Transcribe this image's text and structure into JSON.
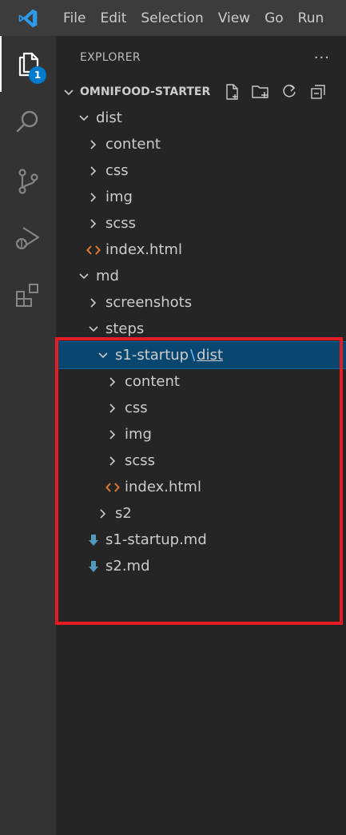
{
  "menu": [
    "File",
    "Edit",
    "Selection",
    "View",
    "Go",
    "Run"
  ],
  "activity": {
    "explorer_badge": "1"
  },
  "sidebar": {
    "title": "EXPLORER",
    "more": "···",
    "section_title": "OMNIFOOD-STARTER",
    "tree": [
      {
        "label": "dist",
        "depth": 0,
        "type": "folder-open"
      },
      {
        "label": "content",
        "depth": 1,
        "type": "folder"
      },
      {
        "label": "css",
        "depth": 1,
        "type": "folder"
      },
      {
        "label": "img",
        "depth": 1,
        "type": "folder"
      },
      {
        "label": "scss",
        "depth": 1,
        "type": "folder"
      },
      {
        "label": "index.html",
        "depth": 1,
        "type": "html"
      },
      {
        "label": "md",
        "depth": 0,
        "type": "folder-open"
      },
      {
        "label": "screenshots",
        "depth": 1,
        "type": "folder"
      },
      {
        "label": "steps",
        "depth": 1,
        "type": "folder-open"
      },
      {
        "label": "s1-startup",
        "sep": "\\",
        "link": "dist",
        "depth": 2,
        "type": "folder-open",
        "selected": true
      },
      {
        "label": "content",
        "depth": 3,
        "type": "folder"
      },
      {
        "label": "css",
        "depth": 3,
        "type": "folder"
      },
      {
        "label": "img",
        "depth": 3,
        "type": "folder"
      },
      {
        "label": "scss",
        "depth": 3,
        "type": "folder"
      },
      {
        "label": "index.html",
        "depth": 3,
        "type": "html"
      },
      {
        "label": "s2",
        "depth": 2,
        "type": "folder"
      },
      {
        "label": "s1-startup.md",
        "depth": 1,
        "type": "md"
      },
      {
        "label": "s2.md",
        "depth": 1,
        "type": "md"
      }
    ]
  },
  "colors": {
    "accent": "#007acc",
    "selection": "#094771",
    "highlight": "#e51c23",
    "html_icon": "#e37933",
    "md_icon": "#519aba"
  }
}
